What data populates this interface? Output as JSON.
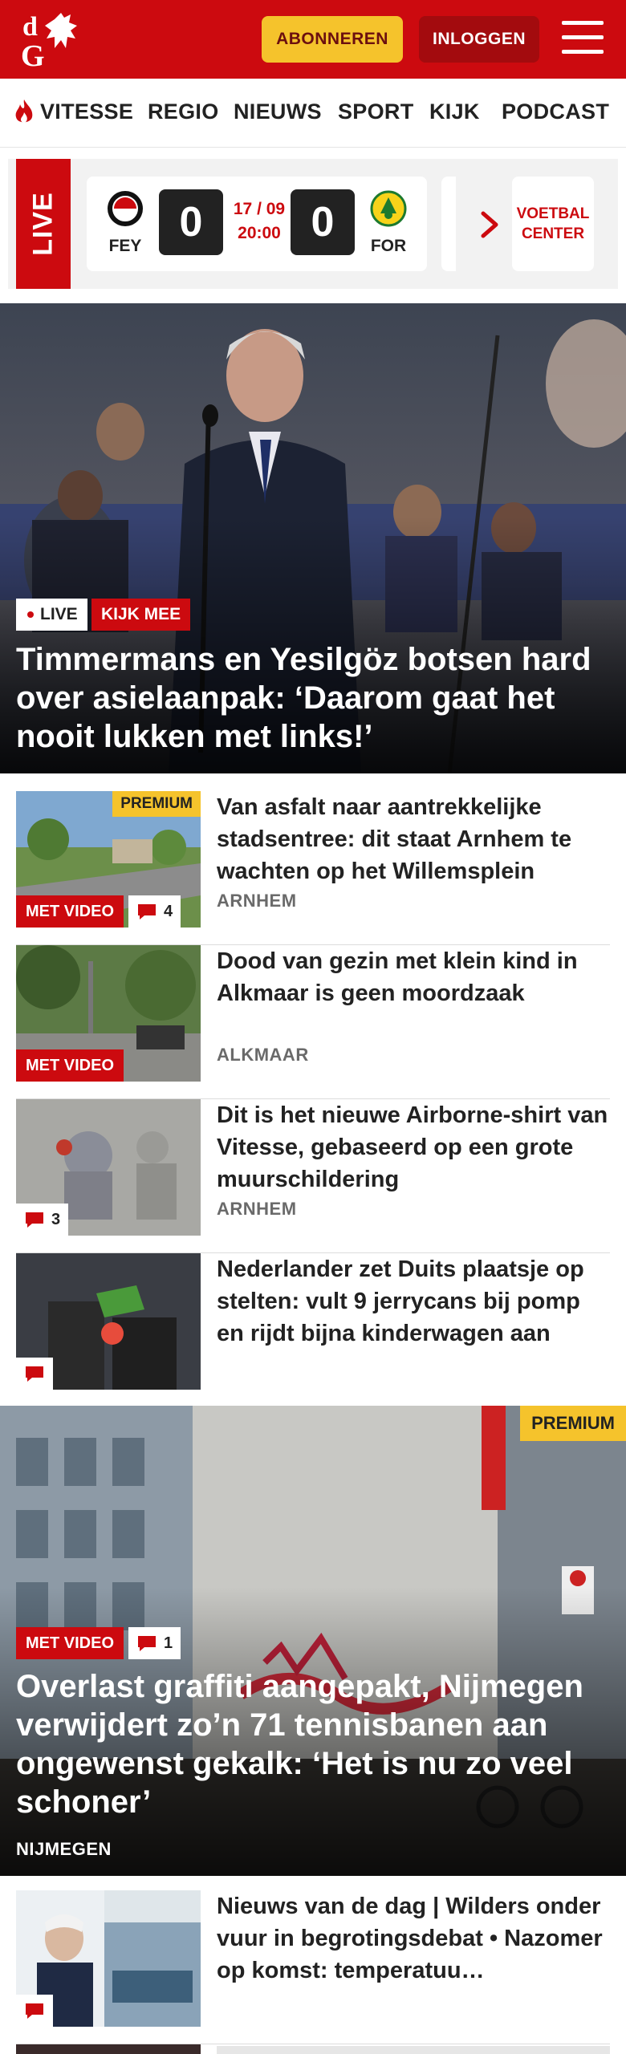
{
  "header": {
    "logo_text": "dG",
    "subscribe_label": "ABONNEREN",
    "login_label": "INLOGGEN",
    "brand_color": "#cc0a0f",
    "accent_color": "#f5c32c"
  },
  "nav": {
    "items": [
      {
        "label": "VITESSE",
        "icon": "flame-icon"
      },
      {
        "label": "REGIO"
      },
      {
        "label": "NIEUWS"
      },
      {
        "label": "SPORT"
      },
      {
        "label": "KIJK"
      },
      {
        "label": "PODCAST"
      }
    ]
  },
  "live": {
    "label": "LIVE",
    "home_team": "FEY",
    "away_team": "FOR",
    "home_score": "0",
    "away_score": "0",
    "date": "17 / 09",
    "time": "20:00",
    "voetbal_center_line1": "VOETBAL",
    "voetbal_center_line2": "CENTER"
  },
  "hero": {
    "live_badge": "LIVE",
    "watch_badge": "KIJK MEE",
    "title": "Timmermans en Yesilgöz botsen hard over asielaanpak: ‘Daarom gaat het nooit lukken met links!’"
  },
  "articles": [
    {
      "title": "Van asfalt naar aantrekkelijke stadsentree: dit staat Arnhem te wachten op het Willemsplein",
      "location": "ARNHEM",
      "premium": "PREMIUM",
      "video": "MET VIDEO",
      "comments": "4"
    },
    {
      "title": "Dood van gezin met klein kind in Alkmaar is geen moordzaak",
      "location": "ALKMAAR",
      "video": "MET VIDEO"
    },
    {
      "title": "Dit is het nieuwe Airborne-shirt van Vitesse, gebaseerd op een grote muurschildering",
      "location": "ARNHEM",
      "comments": "3"
    },
    {
      "title": "Nederlander zet Duits plaatsje op stelten: vult 9 jerrycans bij pomp en rijdt bijna kinderwagen aan",
      "location": ""
    }
  ],
  "big_article": {
    "premium": "PREMIUM",
    "video": "MET VIDEO",
    "comments": "1",
    "title": "Overlast graffiti aangepakt, Nijmegen verwijdert zo’n 71 tennisbanen aan ongewenst gekalk: ‘Het is nu zo veel schoner’",
    "location": "NIJMEGEN"
  },
  "bottom_article": {
    "title": "Nieuws van de dag | Wilders onder vuur in begrotingsdebat • Nazomer op komst: temperatuu…"
  }
}
